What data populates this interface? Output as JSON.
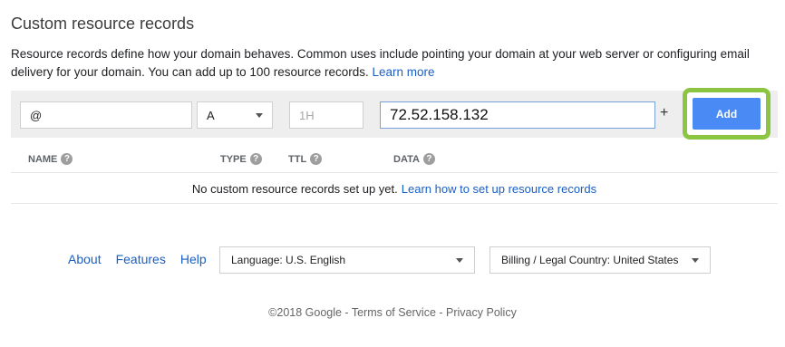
{
  "section": {
    "title": "Custom resource records",
    "description": "Resource records define how your domain behaves. Common uses include pointing your domain at your web server or configuring email delivery for your domain. You can add up to 100 resource records.",
    "learn_more": "Learn more"
  },
  "entry": {
    "name_value": "@",
    "type_value": "A",
    "ttl_placeholder": "1H",
    "data_value": "72.52.158.132",
    "plus_label": "+",
    "add_label": "Add",
    "highlight_color": "#8bc541",
    "add_color": "#4a8af4"
  },
  "table": {
    "headers": [
      "NAME",
      "TYPE",
      "TTL",
      "DATA"
    ],
    "help_glyph": "?",
    "empty_text": "No custom resource records set up yet.",
    "empty_link": "Learn how to set up resource records"
  },
  "footer": {
    "links": [
      "About",
      "Features",
      "Help"
    ],
    "language_select": "Language: U.S. English",
    "country_select": "Billing / Legal Country: United States",
    "copyright": "©2018 Google - Terms of Service - Privacy Policy"
  },
  "icons": {
    "dropdown": "chevron-down-icon",
    "help": "help-circle-icon"
  }
}
